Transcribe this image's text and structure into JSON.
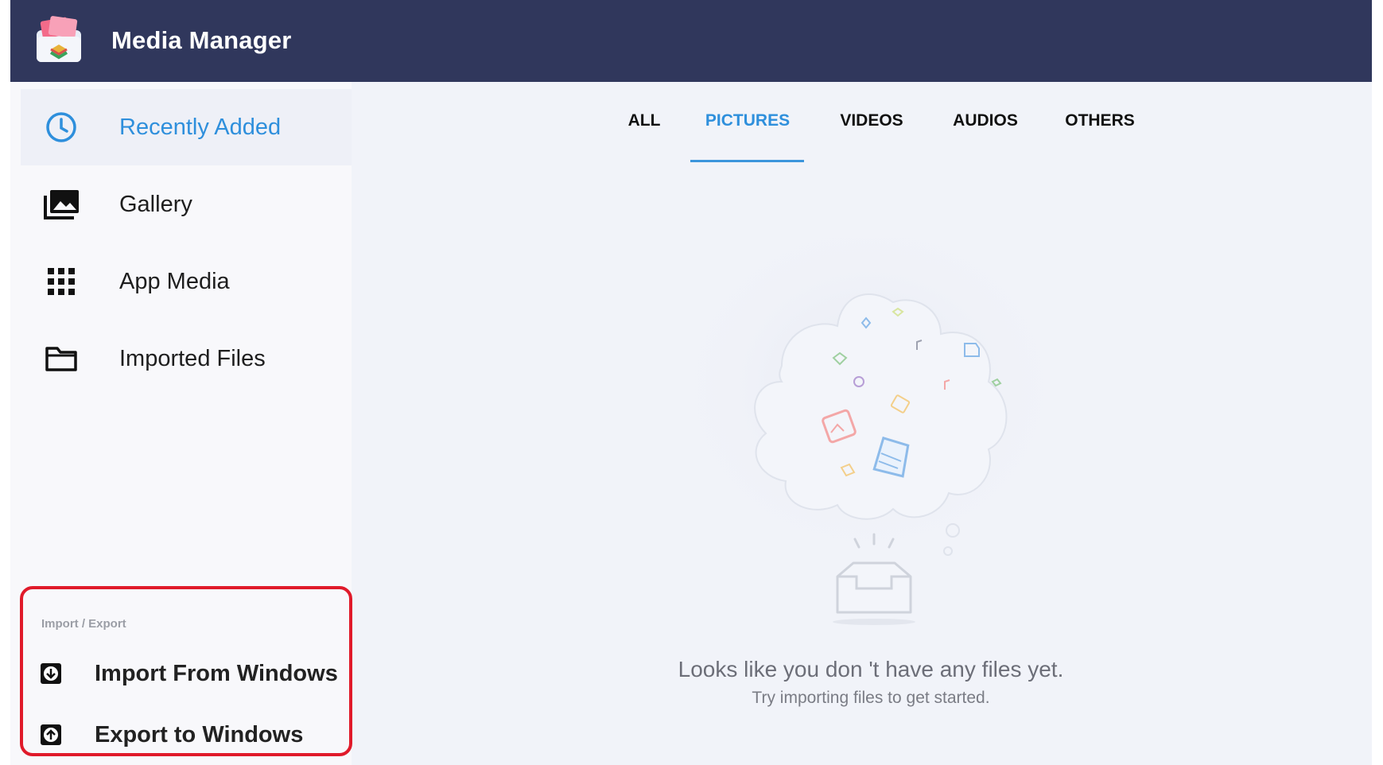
{
  "header": {
    "title": "Media Manager",
    "logo_icon": "media-manager-logo",
    "background": "#30375c"
  },
  "sidebar": {
    "items": [
      {
        "label": "Recently Added",
        "icon": "clock-icon",
        "active": true
      },
      {
        "label": "Gallery",
        "icon": "gallery-icon",
        "active": false
      },
      {
        "label": "App Media",
        "icon": "grid-icon",
        "active": false
      },
      {
        "label": "Imported Files",
        "icon": "folder-icon",
        "active": false
      }
    ],
    "import_export": {
      "header": "Import / Export",
      "import_label": "Import From Windows",
      "export_label": "Export to Windows"
    }
  },
  "tabs": [
    {
      "label": "ALL",
      "active": false
    },
    {
      "label": "PICTURES",
      "active": true
    },
    {
      "label": "VIDEOS",
      "active": false
    },
    {
      "label": "AUDIOS",
      "active": false
    },
    {
      "label": "OTHERS",
      "active": false
    }
  ],
  "empty_state": {
    "title": "Looks like you don 't have any files yet.",
    "subtitle": "Try importing files to get started.",
    "illustration_icon": "empty-inbox-cloud-illustration"
  },
  "colors": {
    "accent": "#2e8fdc",
    "highlight_border": "#e01a2a"
  }
}
